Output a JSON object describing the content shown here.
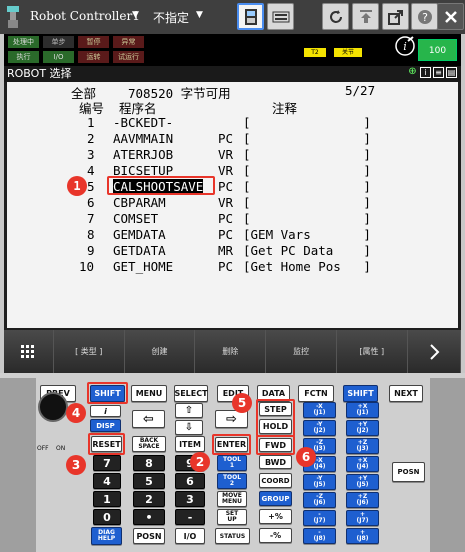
{
  "topbar": {
    "controller": "Robot Controller1",
    "mode": "不指定"
  },
  "status": {
    "leds_row1": [
      "处理中",
      "单步",
      "暂停",
      "异常"
    ],
    "leds_row2": [
      "执行",
      "I/O",
      "运转",
      "试运行"
    ],
    "tag1": "T2",
    "tag2": "关节",
    "battery": "100"
  },
  "screen_title": "ROBOT 选择",
  "header": {
    "left": "全部",
    "bytes": "708520 字节可用",
    "page": "5/27"
  },
  "columns": {
    "num": "编号",
    "name": "程序名",
    "comment": "注释"
  },
  "rows": [
    {
      "n": "1",
      "name": "-BCKEDT-",
      "type": "",
      "comment": "[               ]"
    },
    {
      "n": "2",
      "name": "AAVMMAIN",
      "type": "PC",
      "comment": "[               ]"
    },
    {
      "n": "3",
      "name": "ATERRJOB",
      "type": "VR",
      "comment": "[               ]"
    },
    {
      "n": "4",
      "name": "BICSETUP",
      "type": "VR",
      "comment": "[               ]"
    },
    {
      "n": "5",
      "name": "CALSHOOTSAVE",
      "type": "PC",
      "comment": "[               ]"
    },
    {
      "n": "6",
      "name": "CBPARAM",
      "type": "VR",
      "comment": "[               ]"
    },
    {
      "n": "7",
      "name": "COMSET",
      "type": "PC",
      "comment": "[               ]"
    },
    {
      "n": "8",
      "name": "GEMDATA",
      "type": "PC",
      "comment": "[GEM Vars       ]"
    },
    {
      "n": "9",
      "name": "GETDATA",
      "type": "MR",
      "comment": "[Get PC Data    ]"
    },
    {
      "n": "10",
      "name": "GET_HOME",
      "type": "PC",
      "comment": "[Get Home Pos   ]"
    }
  ],
  "softkeys": [
    "[ 类型 ]",
    "创建",
    "删除",
    "监控",
    "[属性 ]"
  ],
  "keys": {
    "prev": "PREV",
    "shift": "SHIFT",
    "menu": "MENU",
    "select": "SELECT",
    "edit": "EDIT",
    "data": "DATA",
    "fctn": "FCTN",
    "next": "NEXT",
    "disp": "DISP",
    "reset": "RESET",
    "backspace1": "BACK",
    "backspace2": "SPACE",
    "item": "ITEM",
    "enter": "ENTER",
    "step": "STEP",
    "hold": "HOLD",
    "fwd": "FWD",
    "bwd": "BWD",
    "coord": "COORD",
    "group": "GROUP",
    "tool1a": "TOOL",
    "tool1b": "1",
    "tool2a": "TOOL",
    "tool2b": "2",
    "move1": "MOVE",
    "move2": "MENU",
    "setup1": "SET",
    "setup2": "UP",
    "status": "STATUS",
    "io": "I/O",
    "posn": "POSN",
    "posn2": "POSN",
    "diag1": "DIAG",
    "diag2": "HELP",
    "off": "OFF",
    "on": "ON",
    "n7": "7",
    "n8": "8",
    "n9": "9",
    "n4": "4",
    "n5": "5",
    "n6": "6",
    "n1": "1",
    "n2": "2",
    "n3": "3",
    "n0": "0",
    "dot": "•",
    "minus": "-",
    "comma": ",",
    "pct_minus": "-%",
    "pct_plus": "+%",
    "jx": [
      "-X",
      "+X",
      "-Y",
      "+Y",
      "-Z",
      "+Z",
      "-X",
      "+X",
      "-Y",
      "+Y",
      "-Z",
      "+Z",
      "-",
      "+",
      "-",
      "+"
    ],
    "jj": [
      "(J1)",
      "(J1)",
      "(J2)",
      "(J2)",
      "(J3)",
      "(J3)",
      "(J4)",
      "(J4)",
      "(J5)",
      "(J5)",
      "(J6)",
      "(J6)",
      "(J7)",
      "(J7)",
      "(J8)",
      "(J8)"
    ]
  },
  "markers": [
    "1",
    "2",
    "3",
    "4",
    "5",
    "6"
  ]
}
